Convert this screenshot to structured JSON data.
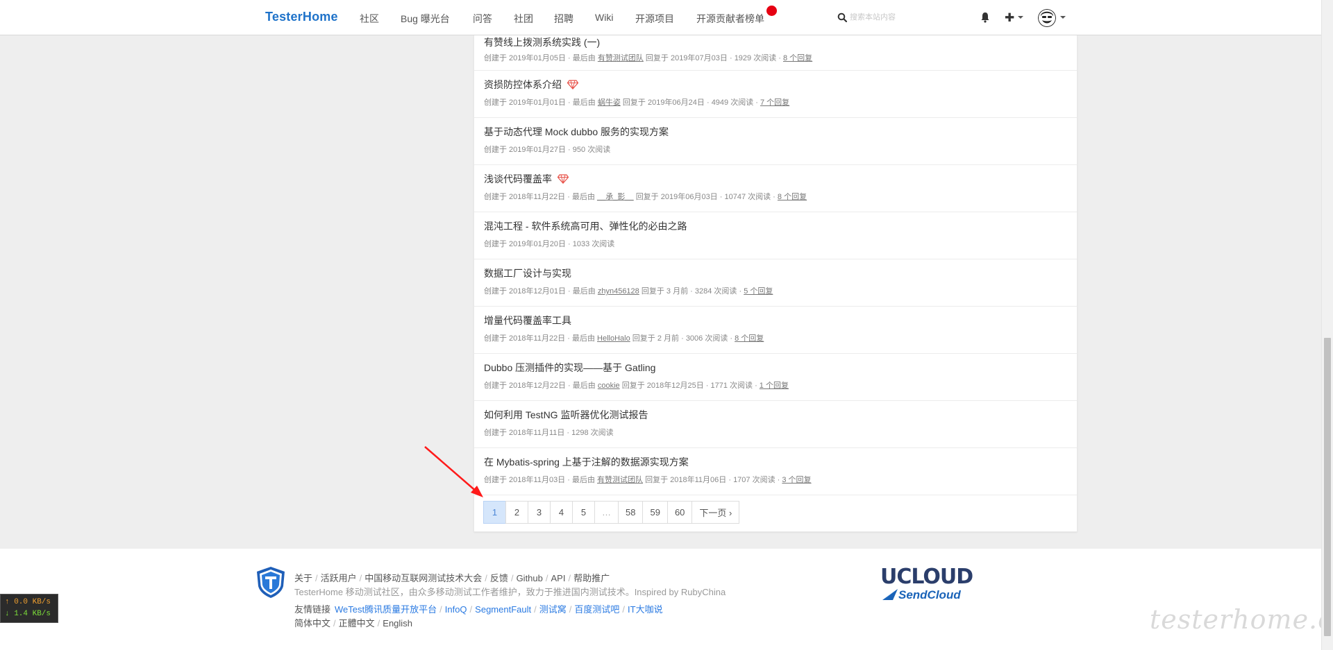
{
  "navbar": {
    "brand": "TesterHome",
    "items": [
      "社区",
      "Bug 曝光台",
      "问答",
      "社团",
      "招聘",
      "Wiki",
      "开源项目",
      "开源贡献者榜单"
    ],
    "search_placeholder": "搜索本站内容"
  },
  "topics": [
    {
      "title": "有赞线上拨测系统实践 (一)",
      "created": "创建于 2019年01月05日",
      "last_by_label": "最后由",
      "last_by": "有赞测试团队",
      "replied": "回复于 2019年07月03日",
      "reads": "1929 次阅读",
      "replies": "8 个回复",
      "diamond": false
    },
    {
      "title": "资损防控体系介绍",
      "created": "创建于 2019年01月01日",
      "last_by_label": "最后由",
      "last_by": "蜗牛姿",
      "replied": "回复于 2019年06月24日",
      "reads": "4949 次阅读",
      "replies": "7 个回复",
      "diamond": true
    },
    {
      "title": "基于动态代理 Mock dubbo 服务的实现方案",
      "created": "创建于 2019年01月27日",
      "reads": "950 次阅读",
      "diamond": false
    },
    {
      "title": "浅谈代码覆盖率",
      "created": "创建于 2018年11月22日",
      "last_by_label": "最后由",
      "last_by": "__承_影__",
      "replied": "回复于 2019年06月03日",
      "reads": "10747 次阅读",
      "replies": "8 个回复",
      "diamond": true
    },
    {
      "title": "混沌工程 - 软件系统高可用、弹性化的必由之路",
      "created": "创建于 2019年01月20日",
      "reads": "1033 次阅读",
      "diamond": false
    },
    {
      "title": "数据工厂设计与实现",
      "created": "创建于 2018年12月01日",
      "last_by_label": "最后由",
      "last_by": "zhyn456128",
      "replied": "回复于 3 月前",
      "reads": "3284 次阅读",
      "replies": "5 个回复",
      "diamond": false
    },
    {
      "title": "增量代码覆盖率工具",
      "created": "创建于 2018年11月22日",
      "last_by_label": "最后由",
      "last_by": "HelloHalo",
      "replied": "回复于 2 月前",
      "reads": "3006 次阅读",
      "replies": "8 个回复",
      "diamond": false
    },
    {
      "title": "Dubbo 压测插件的实现——基于 Gatling",
      "created": "创建于 2018年12月22日",
      "last_by_label": "最后由",
      "last_by": "cookie",
      "replied": "回复于 2018年12月25日",
      "reads": "1771 次阅读",
      "replies": "1 个回复",
      "diamond": false
    },
    {
      "title": "如何利用 TestNG 监听器优化测试报告",
      "created": "创建于 2018年11月11日",
      "reads": "1298 次阅读",
      "diamond": false
    },
    {
      "title": "在 Mybatis-spring 上基于注解的数据源实现方案",
      "created": "创建于 2018年11月03日",
      "last_by_label": "最后由",
      "last_by": "有赞测试团队",
      "replied": "回复于 2018年11月06日",
      "reads": "1707 次阅读",
      "replies": "3 个回复",
      "diamond": false
    }
  ],
  "pagination": {
    "pages": [
      "1",
      "2",
      "3",
      "4",
      "5",
      "…",
      "58",
      "59",
      "60"
    ],
    "active": "1",
    "next": "下一页 ›"
  },
  "footer": {
    "links": [
      "关于",
      "活跃用户",
      "中国移动互联网测试技术大会",
      "反馈",
      "Github",
      "API",
      "帮助推广"
    ],
    "description": "TesterHome 移动测试社区，由众多移动测试工作者维护，致力于推进国内测试技术。Inspired by RubyChina",
    "friend_label": "友情链接",
    "friend_links": [
      "WeTest腾讯质量开放平台",
      "InfoQ",
      "SegmentFault",
      "测试窝",
      "百度测试吧",
      "IT大咖说"
    ],
    "languages": [
      "简体中文",
      "正體中文",
      "English"
    ],
    "sponsor_top": "UCLOUD",
    "sponsor_bottom": "SendCloud",
    "watermark": "testerhome.com"
  },
  "netspeed": {
    "up": "↑ 0.0 KB/s",
    "down": "↓ 1.4 KB/s"
  },
  "colors": {
    "brand": "#1e72c9",
    "accent_red": "#e60012",
    "link_blue": "#2a7ae2",
    "active_page_bg": "#d5e6fb"
  }
}
